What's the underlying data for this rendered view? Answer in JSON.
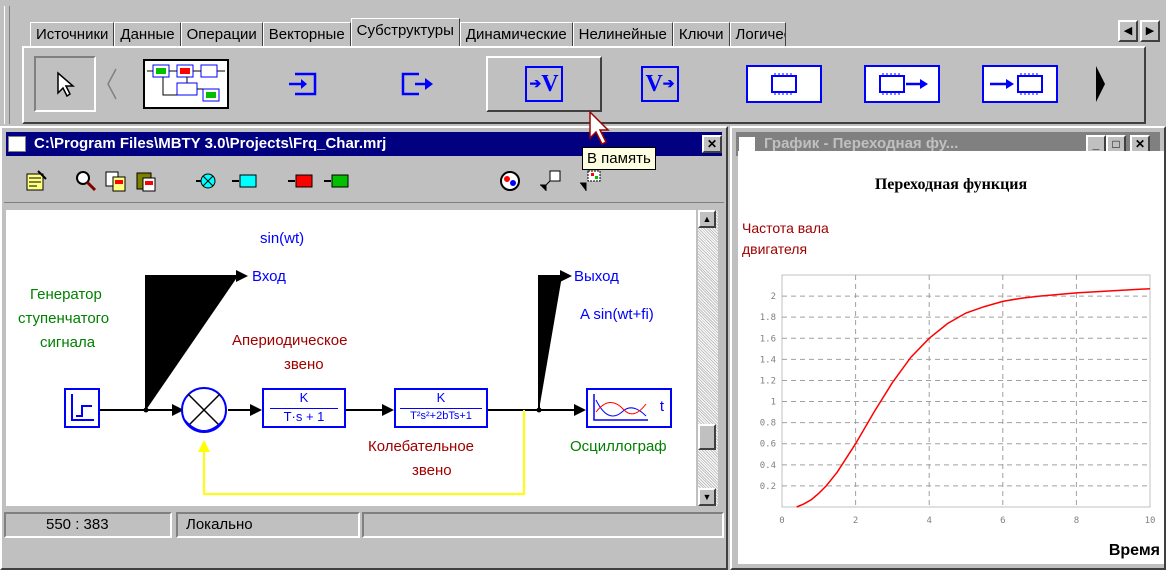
{
  "palette": {
    "tabs": [
      "Источники",
      "Данные",
      "Операции",
      "Векторные",
      "Субструктуры",
      "Динамические",
      "Нелинейные",
      "Ключи",
      "Логичес"
    ],
    "active_tab": "Субструктуры",
    "buttons": [
      {
        "name": "pointer",
        "icon": "cursor-arrow-icon"
      },
      {
        "name": "scroll-left",
        "icon": "chevron-left-icon"
      },
      {
        "name": "substructure",
        "icon": "substructure-block-icon"
      },
      {
        "name": "input-port",
        "icon": "input-port-icon"
      },
      {
        "name": "output-port",
        "icon": "output-port-icon"
      },
      {
        "name": "to-memory",
        "icon": "to-memory-icon",
        "label": "V"
      },
      {
        "name": "from-memory",
        "icon": "from-memory-icon",
        "label": "V"
      },
      {
        "name": "chip",
        "icon": "chip-icon"
      },
      {
        "name": "chip-out",
        "icon": "chip-output-icon"
      },
      {
        "name": "chip-in",
        "icon": "chip-input-icon"
      },
      {
        "name": "scroll-right",
        "icon": "chevron-right-icon"
      }
    ]
  },
  "model_window": {
    "title": "C:\\Program Files\\MBTY 3.0\\Projects\\Frq_Char.mrj",
    "tooltip": "В память",
    "diagram": {
      "sin_label": "sin(wt)",
      "input_label": "Вход",
      "output_label": "Выход",
      "generator_label": "Генератор ступенчатого сигнала",
      "generator_lines": [
        "Генератор",
        "ступенчатого",
        "сигнала"
      ],
      "output_formula": "A sin(wt+fi)",
      "aperiodic_lines": [
        "Апериодическое",
        "звено"
      ],
      "oscillating_lines": [
        "Колебательное",
        "звено"
      ],
      "aperiodic_num": "K",
      "aperiodic_den": "T·s + 1",
      "oscillating_num": "K",
      "oscillating_den": "T²s²+2bTs+1",
      "oscilloscope_label": "Осциллограф",
      "oscilloscope_t": "t"
    },
    "status": {
      "coords": "550 : 383",
      "mode": "Локально",
      "extra": ""
    }
  },
  "graph_window": {
    "title": "График - Переходная фу...",
    "colors": {
      "curve": "#ff0000",
      "title_inactive": "#808080"
    }
  },
  "chart_data": {
    "type": "line",
    "title": "Переходная функция",
    "ylabel": "Частота вала двигателя",
    "ylabel_lines": [
      "Частота вала",
      "двигателя"
    ],
    "xlabel": "Время",
    "xlim": [
      0,
      10
    ],
    "ylim": [
      0,
      2.2
    ],
    "x_ticks": [
      "0",
      "2",
      "4",
      "6",
      "8",
      "10"
    ],
    "y_ticks": [
      "0.2",
      "0.4",
      "0.6",
      "0.8",
      "1",
      "1.2",
      "1.4",
      "1.6",
      "1.8",
      "2"
    ],
    "grid": true,
    "series": [
      {
        "x": [
          0.4,
          0.6,
          0.8,
          1.0,
          1.2,
          1.5,
          2.0,
          2.5,
          3.0,
          3.5,
          4.0,
          4.5,
          5.0,
          5.5,
          6.0,
          6.5,
          7.0,
          8.0,
          9.0,
          10.0
        ],
        "y": [
          0.0,
          0.03,
          0.07,
          0.13,
          0.2,
          0.33,
          0.6,
          0.9,
          1.18,
          1.42,
          1.6,
          1.74,
          1.84,
          1.9,
          1.95,
          1.98,
          2.0,
          2.03,
          2.05,
          2.07
        ]
      }
    ]
  }
}
